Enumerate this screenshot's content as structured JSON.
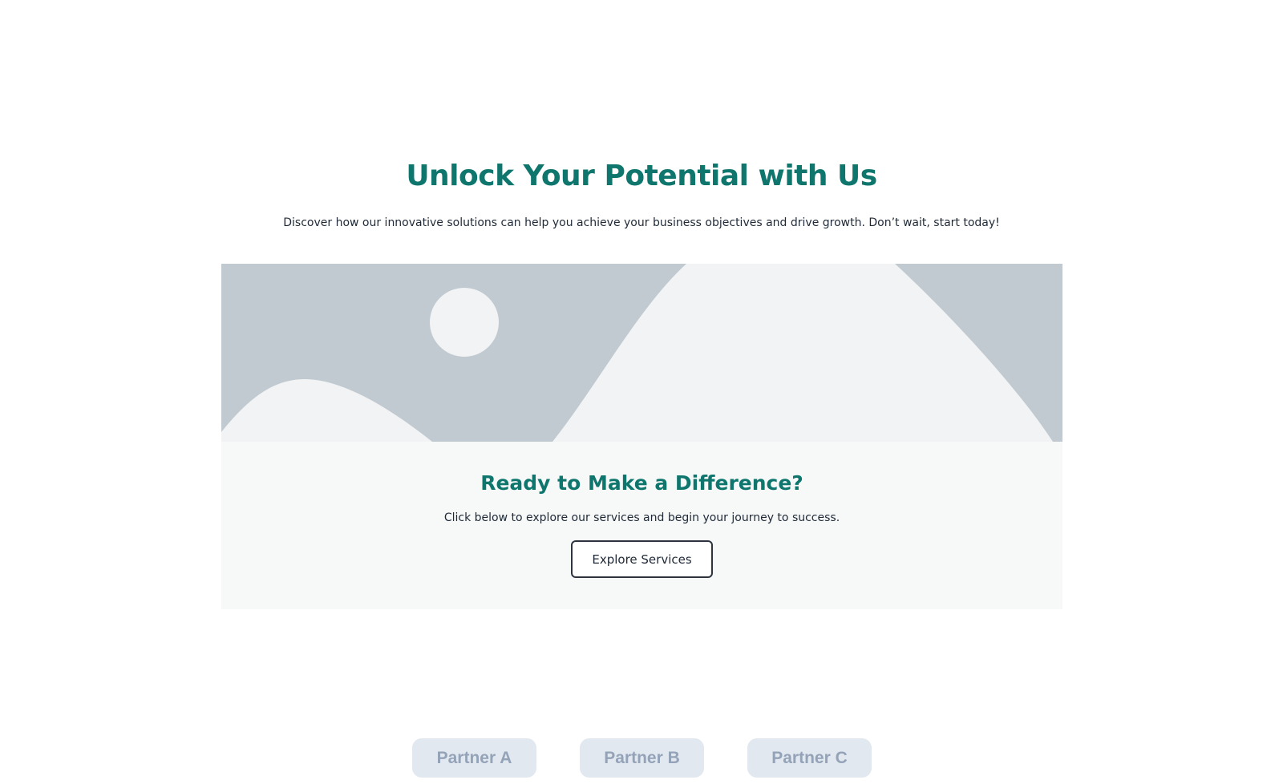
{
  "colors": {
    "accent": "#0f766e",
    "text": "#1f2937",
    "image_bg": "#c2cad1",
    "image_fg": "#f1f3f4",
    "card_bg": "#f7f9f9",
    "partner_bg": "#e2e8f0",
    "partner_text": "#94a3b8"
  },
  "hero": {
    "title": "Unlock Your Potential with Us",
    "subtitle": "Discover how our innovative solutions can help you achieve your business objectives and drive growth. Don’t wait, start today!"
  },
  "card": {
    "image_icon": "image-placeholder-icon",
    "title": "Ready to Make a Difference?",
    "text": "Click below to explore our services and begin your journey to success.",
    "button_label": "Explore Services"
  },
  "partners": [
    {
      "label": "Partner A"
    },
    {
      "label": "Partner B"
    },
    {
      "label": "Partner C"
    }
  ]
}
